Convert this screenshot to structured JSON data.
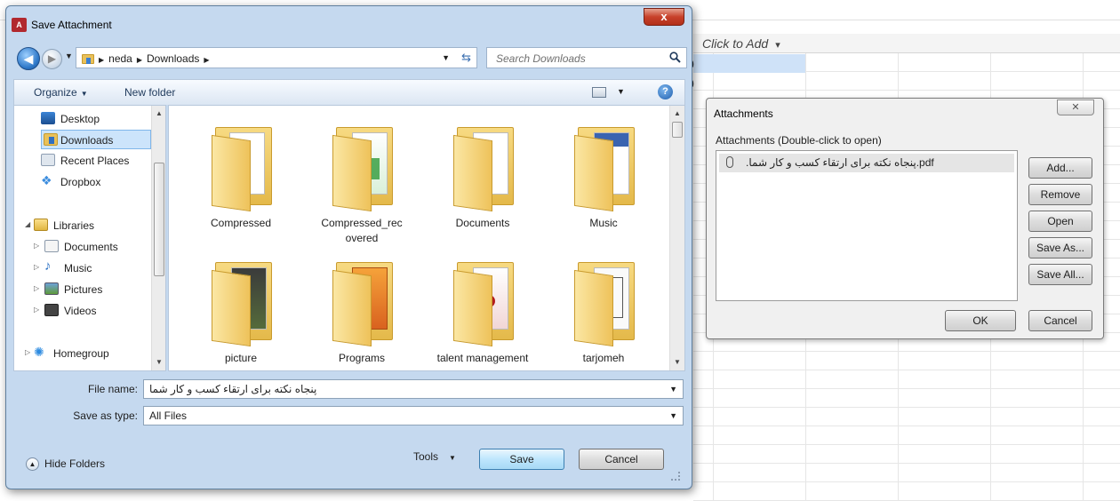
{
  "background": {
    "click_to_add": "Click to Add",
    "zero_a": "0",
    "zero_b": "0"
  },
  "save_dialog": {
    "title": "Save Attachment",
    "app_icon_text": "A",
    "close_glyph": "x",
    "breadcrumb": [
      "neda",
      "Downloads"
    ],
    "search_placeholder": "Search Downloads",
    "toolbar": {
      "organize": "Organize",
      "new_folder": "New folder"
    },
    "nav_items": [
      {
        "label": "Desktop",
        "icon": "desktop-icon"
      },
      {
        "label": "Downloads",
        "icon": "downloads-folder-icon",
        "selected": true
      },
      {
        "label": "Recent Places",
        "icon": "recent-places-icon"
      },
      {
        "label": "Dropbox",
        "icon": "dropbox-icon"
      },
      {
        "label": "Libraries",
        "icon": "libraries-icon"
      },
      {
        "label": "Documents",
        "icon": "documents-icon"
      },
      {
        "label": "Music",
        "icon": "music-icon"
      },
      {
        "label": "Pictures",
        "icon": "pictures-icon"
      },
      {
        "label": "Videos",
        "icon": "videos-icon"
      },
      {
        "label": "Homegroup",
        "icon": "homegroup-icon"
      }
    ],
    "files": [
      {
        "name": "Compressed"
      },
      {
        "name": "Compressed_rec overed"
      },
      {
        "name": "Documents"
      },
      {
        "name": "Music"
      },
      {
        "name": "picture"
      },
      {
        "name": "Programs"
      },
      {
        "name": "talent management"
      },
      {
        "name": "tarjomeh"
      }
    ],
    "file_name_label": "File name:",
    "file_name_value": "پنجاه نکته برای ارتقاء کسب و کار شما",
    "save_as_type_label": "Save as type:",
    "save_as_type_value": "All Files",
    "hide_folders": "Hide Folders",
    "tools": "Tools",
    "save": "Save",
    "cancel": "Cancel"
  },
  "attachments_dialog": {
    "title": "Attachments",
    "group_label": "Attachments (Double-click to open)",
    "file_name": ".پنجاه نکته برای ارتقاء کسب و کار شما.pdf",
    "buttons": {
      "add": "Add...",
      "remove": "Remove",
      "open": "Open",
      "save_as": "Save As...",
      "save_all": "Save All...",
      "ok": "OK",
      "cancel": "Cancel"
    }
  }
}
